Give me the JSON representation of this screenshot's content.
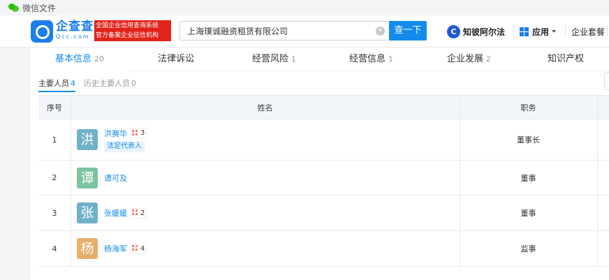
{
  "window": {
    "title": "微信文件"
  },
  "header": {
    "brand_cn": "企查查",
    "brand_en": "Qcc.com",
    "slogan_line1": "全国企业信用查询系统",
    "slogan_line2": "官方备案企业征信机构",
    "search_value": "上海璞诚融资租赁有限公司",
    "search_button": "查一下",
    "zhibi_icon_glyph": "C",
    "zhibi_label": "知彼阿尔法",
    "apps_label": "应用",
    "package_label": "企业套餐"
  },
  "tabs": [
    {
      "label": "基本信息",
      "count": "20"
    },
    {
      "label": "法律诉讼",
      "count": ""
    },
    {
      "label": "经营风险",
      "count": "1"
    },
    {
      "label": "经营信息",
      "count": "1"
    },
    {
      "label": "企业发展",
      "count": "2"
    },
    {
      "label": "知识产权",
      "count": ""
    }
  ],
  "subtabs": [
    {
      "label": "主要人员",
      "count": "4"
    },
    {
      "label": "历史主要人员",
      "count": "0"
    }
  ],
  "table": {
    "headers": {
      "index": "序号",
      "name": "姓名",
      "position": "职务"
    },
    "rows": [
      {
        "index": "1",
        "avatar_char": "洪",
        "avatar_color": "#6fb1c8",
        "name": "洪赛华",
        "relations": "3",
        "tag": "法定代表人",
        "position": "董事长"
      },
      {
        "index": "2",
        "avatar_char": "谭",
        "avatar_color": "#7cc4a0",
        "name": "谭可及",
        "relations": "",
        "tag": "",
        "position": "董事"
      },
      {
        "index": "3",
        "avatar_char": "张",
        "avatar_color": "#6fb1c8",
        "name": "张媛媛",
        "relations": "2",
        "tag": "",
        "position": "董事"
      },
      {
        "index": "4",
        "avatar_char": "杨",
        "avatar_color": "#e6ae6a",
        "name": "杨海军",
        "relations": "4",
        "tag": "",
        "position": "监事"
      }
    ]
  },
  "colors": {
    "accent": "#128bed",
    "brand": "#1b7eea",
    "slogan_bg": "#e2231a"
  }
}
